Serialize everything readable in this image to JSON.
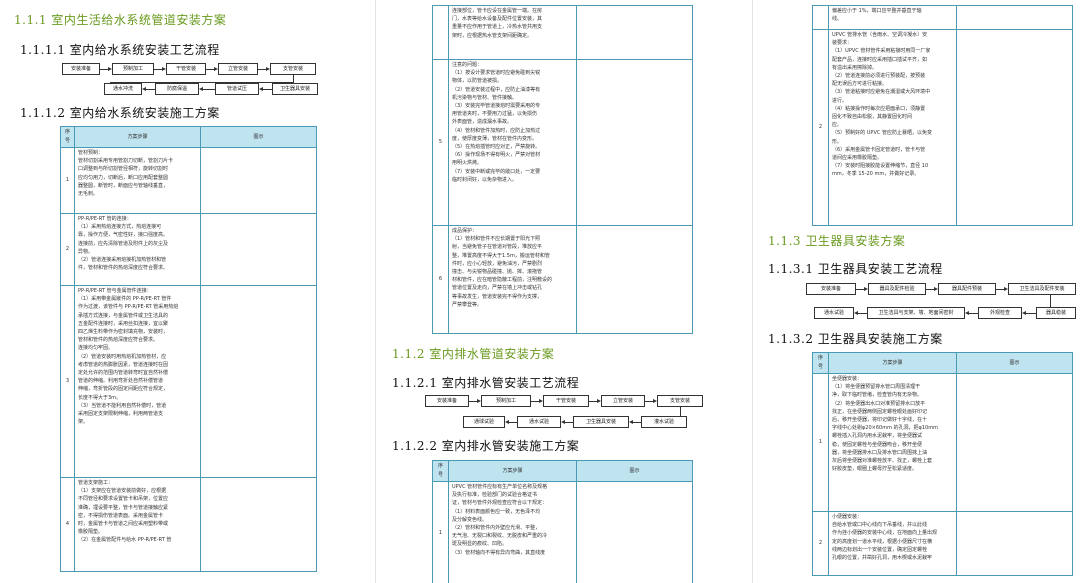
{
  "page1": {
    "h_1_1_1": "1.1.1 室内生活给水系统管道安装方案",
    "h_1_1_1_1": "1.1.1.1 室内给水系统安装工艺流程",
    "flow_row1": [
      "安装准备",
      "预制加工",
      "干管安装",
      "立管安装",
      "支管安装"
    ],
    "flow_row2": [
      "通水冲洗",
      "防腐保温",
      "管道试压",
      "卫生器具安装"
    ],
    "h_1_1_1_2": "1.1.1.2 室内给水系统安装施工方案",
    "table_head": [
      "序号",
      "方案步骤",
      "图示"
    ],
    "rows": [
      {
        "no": "1",
        "lines": [
          "管材预制：",
          "管材切割采用专用管割刀切断，管割刀片卡",
          "口调整到与所切割管径相符，旋转切割时",
          "应均匀用力，切断后，断口应用配套整圆",
          "器整圆，断管时，断面应与管轴线垂直，",
          "无毛刺。"
        ]
      },
      {
        "no": "2",
        "lines": [
          "PP-R/PE-RT 管的连接：",
          "（1）采用热熔连接方式，热熔连接可",
          "靠，操作方便，气密性好，接口强度高。",
          "连接前，应先清除管道及附件上的灰尘及",
          "异物。",
          "（2）管道连接采用熔接机加热管材和管",
          "件，管材和管件的热熔深度应符合要求。"
        ]
      },
      {
        "no": "3",
        "lines": [
          "PP-R/PE-RT 管与金属管件连接：",
          "（1）采用带金属嵌件的 PP-R/PE-RT 管件",
          "作为过渡，该管件与 PP-R/PE-RT 管采用热熔",
          "承插方式连接，与金属管件或卫生洁具的",
          "五金配件连接时，采用丝扣连接，宜以聚",
          "四乙烯生料带作为密封填充物，安装时，",
          "管材和管件的热熔深度应符合要求。",
          "连接均匀牢固。",
          "（2）管道安装时用热熔机加热管材，应",
          "考虑管道的热膨胀因素，管道连接时在固",
          "定处允许的范围内管道转弯时宜自然补偿",
          "管道的伸缩。利用弯折处自然补偿管道",
          "伸缩，弯折管段的固定间距应符合规定，",
          "长度不得大于3m。",
          "（3）当管道不能利用自然补偿时，管道",
          "采用固定支架限制伸缩，利用两管道支",
          "架。"
        ]
      },
      {
        "no": "4",
        "lines": [
          "管道支架施工：",
          "（1）支架应在管道安装前做好，应根据",
          "不同管径和要求设置管卡和吊架，位置应",
          "准确，埋设要平整，管卡与管道接触应紧",
          "密，不得损伤管道表面。采用金属管卡",
          "时，金属管卡与管道之间应采用塑料带或",
          "橡胶隔垫。",
          "（2）在金属管配件与给水 PP-R/PE-RT 管"
        ]
      }
    ]
  },
  "page2": {
    "rows_top": [
      {
        "no": "",
        "lines": [
          "连接部位，管卡应设在金属管一端。在房",
          "门，水表等给水设备及配件位置安装，其",
          "重量不应作用于管道上，冷热水管共用支",
          "架时，应根据热水管支架间距确定。"
        ]
      },
      {
        "no": "5",
        "lines": [
          "注意的问题：",
          "（1）按设计要求管道时应避免碰到尖锐",
          "物体，以防管道被损。",
          "（2）管道安装过程中，应防止油漆等有",
          "机污染物与管材、管件接触。",
          "（3）安装完毕管道接熔时需要采用的专",
          "用管道夹时，不要用力过猛，以免损伤",
          "外表面管，造成漏水事故。",
          "（4）管材和管件加热时，应防止加热过",
          "度，使厚度变薄，管材在管件内变形。",
          "（5）在热熔插管时应对正，严禁旋转。",
          "（6）操作现场不得有明火，严禁对管材",
          "用明火烘烤。",
          "（7）安装中断或完毕的敞口处，一定要",
          "临时封闭好，以免杂物进入。"
        ]
      },
      {
        "no": "6",
        "lines": [
          "成品保护：",
          "（1）管材和管件不应长期置于阳光下照",
          "射，当避免管子在管道对管段，堆放应平",
          "整，堆置高度不得大于1.5m，搬运管材和管",
          "件时，应小心轻放，避免油污，严禁剧烈",
          "撞击、与尖锐物品碰撞、抛、摔、滚拖管",
          "材和管件，应在暗管隐蔽工程前，注明敷设的",
          "管道位置及走向，严禁在墙上冲击或钻孔",
          "等事故发生，管道安装完不得作为支撑，",
          "严禁攀登等。"
        ]
      }
    ],
    "h_1_1_2": "1.1.2 室内排水管道安装方案",
    "h_1_1_2_1": "1.1.2.1 室内排水管安装工艺流程",
    "flow_row1": [
      "安装准备",
      "预制加工",
      "干管安装",
      "立管安装",
      "支管安装"
    ],
    "flow_row2": [
      "通球试验",
      "通水试验",
      "卫生器具安装",
      "灌水试验"
    ],
    "h_1_1_2_2": "1.1.2.2 室内排水管安装施工方案",
    "table_head": [
      "序号",
      "方案步骤",
      "图示"
    ],
    "row1": {
      "no": "1",
      "lines": [
        "UPVC 管材管件应标有生产单位名称及规格",
        "及执行标准，检验部门的试验合格证书",
        "证，管材与管件外观检查应符合以下规定：",
        "（1）材料表面颜色应一致，无色泽不均",
        "及分解变色线。",
        "（2）管材和管件内外壁应光滑、平整，",
        "无气泡、无裂口和裂纹、无脱皮和严重的冷",
        "斑及明显的痕纹、凹陷。",
        "（3）管材轴向不得有异向弯曲，其直线度"
      ]
    }
  },
  "page3": {
    "row_top": {
      "no": "",
      "lines": [
        "偏差应小于 1%，端口应平整并垂直于轴",
        "线。"
      ]
    },
    "row2": {
      "no": "2",
      "lines": [
        "UPVC 管排水管（含雨水、空调冷凝水）安",
        "装要求：",
        "（1）UPVC 管材管件采用粘接时用同一厂家",
        "配套产品，连接时应采用插口插试平齐，如",
        "有溢出采用擦除掉。",
        "（2）管道连接前必须进行预装配，按预装",
        "配无误后方可进行粘接。",
        "（3）管道粘接时应避免在潮湿或大风环境中",
        "进行。",
        "（4）粘接操作时每次应把面承口，须静置",
        "固化不致自由松脱，其静置固化时间",
        "应。",
        "（5）预制好的 UPVC 管应防止暴晒，以免变",
        "形。",
        "（6）采用金属管卡固定管道时，管卡与管",
        "道间应采用橡胶隔垫。",
        "（7）安装时阻接胶能设置伸缩节，直径 10",
        "mm，冬季 15-20 mm，并做好记录。"
      ]
    },
    "h_1_1_3": "1.1.3 卫生器具安装方案",
    "h_1_1_3_1": "1.1.3.1 卫生器具安装工艺流程",
    "flow_row1": [
      "安装准备",
      "器具及配件检验",
      "器具配件预装",
      "卫生洁具及配件安装"
    ],
    "flow_row2": [
      "通水试验",
      "卫生洁具与支架、墙、地面间密封",
      "外观检查",
      "器具稳装"
    ],
    "h_1_1_3_2": "1.1.3.2 卫生器具安装施工方案",
    "table_head": [
      "序号",
      "方案步骤",
      "图示"
    ],
    "rows": [
      {
        "no": "1",
        "lines": [
          "坐便器安装：",
          "（1）将坐便器预留排水管口周围清理干",
          "净，取下临时管堵，检查管内有无杂物。",
          "（2）将坐便器出水口对准预留排水口放平",
          "找正，在坐便器两侧固定螺栓眼处画好印记",
          "后，移开坐便器，将印记做好十字线，在十",
          "字线中心处剔φ20×60mm 的孔洞，把φ10mm",
          "螺栓插入孔洞内用水泥栽牢，将坐便器试",
          "稳，使固定螺栓与坐便器吻合，移开坐便",
          "器，将坐便器排水口及排水管口周围抹上油",
          "灰后将坐便器对准螺栓放平、找正，螺栓上套",
          "好胶皮垫，眼圈上螺母拧至松紧适度。"
        ]
      },
      {
        "no": "2",
        "lines": [
          "小便器安装：",
          "自给水管或口中心线向下吊垂线，并以此线",
          "作为挂小便器的安装中心线，在地面向上量出规",
          "定的高度划一道水平线，根据小便器尺寸在横",
          "线两边标划出一个安装位置，确定固定螺栓",
          "孔眼的位置，并凿好孔洞，用木楔或水泥栽牢"
        ]
      }
    ]
  }
}
